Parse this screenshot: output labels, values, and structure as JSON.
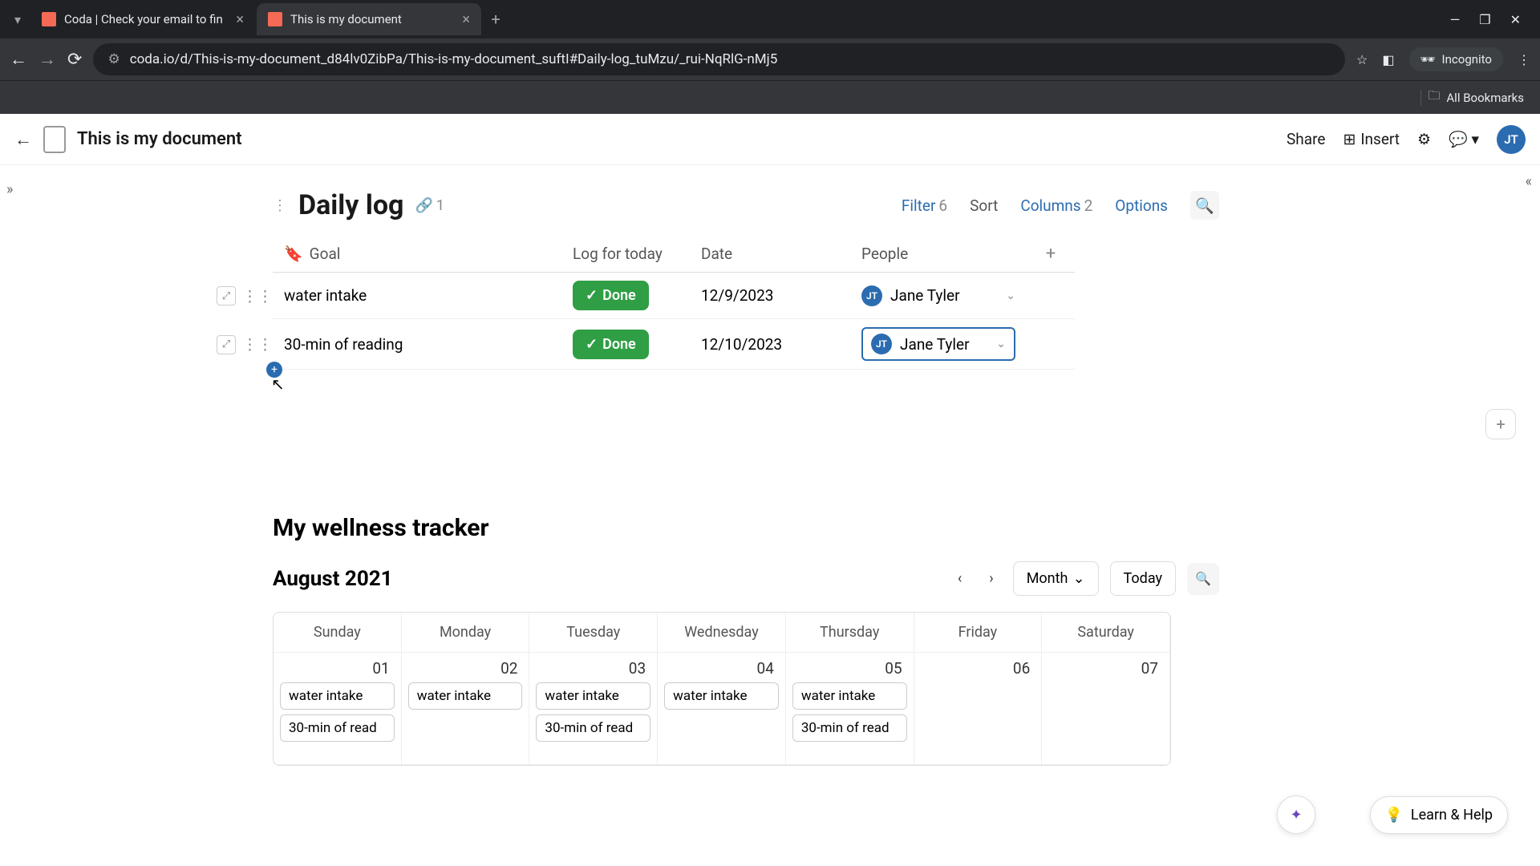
{
  "browser": {
    "tabs": [
      {
        "title": "Coda | Check your email to fin"
      },
      {
        "title": "This is my document"
      }
    ],
    "url": "coda.io/d/This-is-my-document_d84lv0ZibPa/This-is-my-document_suftI#Daily-log_tuMzu/_rui-NqRlG-nMj5",
    "incognito_label": "Incognito",
    "bookmarks_label": "All Bookmarks"
  },
  "app": {
    "doc_title": "This is my document",
    "share_label": "Share",
    "insert_label": "Insert",
    "avatar_initials": "JT"
  },
  "daily_log": {
    "title": "Daily log",
    "ref_count": "1",
    "controls": {
      "filter_label": "Filter",
      "filter_count": "6",
      "sort_label": "Sort",
      "columns_label": "Columns",
      "columns_count": "2",
      "options_label": "Options"
    },
    "columns": {
      "goal": "Goal",
      "log": "Log for today",
      "date": "Date",
      "people": "People"
    },
    "rows": [
      {
        "goal": "water intake",
        "log": "Done",
        "date": "12/9/2023",
        "person": "Jane Tyler",
        "initials": "JT"
      },
      {
        "goal": "30-min of reading",
        "log": "Done",
        "date": "12/10/2023",
        "person": "Jane Tyler",
        "initials": "JT"
      }
    ]
  },
  "tracker": {
    "title": "My wellness tracker",
    "month_label": "August 2021",
    "view_label": "Month",
    "today_label": "Today",
    "day_headers": [
      "Sunday",
      "Monday",
      "Tuesday",
      "Wednesday",
      "Thursday",
      "Friday",
      "Saturday"
    ],
    "week1": {
      "dates": [
        "01",
        "02",
        "03",
        "04",
        "05",
        "06",
        "07"
      ],
      "events": [
        [
          "water intake",
          "30-min of read"
        ],
        [
          "water intake"
        ],
        [
          "water intake",
          "30-min of read"
        ],
        [
          "water intake"
        ],
        [
          "water intake",
          "30-min of read"
        ],
        [],
        []
      ]
    }
  },
  "floating": {
    "learn_help_label": "Learn & Help"
  }
}
